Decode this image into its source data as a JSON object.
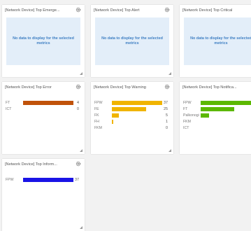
{
  "panels": [
    {
      "title": "[Network Device] Top Emerge...",
      "type": "empty",
      "message": "No data to display for the selected metrics"
    },
    {
      "title": "[Network Device] Top Alert",
      "type": "empty",
      "message": "No data to display for the selected metrics"
    },
    {
      "title": "[Network Device] Top Critical",
      "type": "empty",
      "message": "No data to display for the selected metrics"
    },
    {
      "title": "[Network Device] Top Error",
      "type": "bar",
      "color": "#c0520a",
      "max": 4,
      "rows": [
        {
          "label": "FT",
          "value": 4
        },
        {
          "label": "ICT",
          "value": 0
        }
      ]
    },
    {
      "title": "[Network Device] Top Warning",
      "type": "bar",
      "color": "#f0b400",
      "max": 37,
      "rows": [
        {
          "label": "FPW",
          "value": 37
        },
        {
          "label": "FE",
          "value": 25
        },
        {
          "label": "FK",
          "value": 5
        },
        {
          "label": "FH",
          "value": 1
        },
        {
          "label": "FKM",
          "value": 0
        }
      ]
    },
    {
      "title": "[Network Device] Top Notifica...",
      "type": "bar",
      "color": "#5cb800",
      "max": 6,
      "rows": [
        {
          "label": "FPW",
          "value": 6
        },
        {
          "label": "FT",
          "value": 4
        },
        {
          "label": "Palkonogi",
          "value": 1
        },
        {
          "label": "FKM",
          "value": 0
        },
        {
          "label": "ICT",
          "value": 0
        }
      ]
    },
    {
      "title": "[Network Device] Top Inform...",
      "type": "bar",
      "color": "#1a14e6",
      "max": 37,
      "rows": [
        {
          "label": "FPW",
          "value": 37
        }
      ]
    }
  ],
  "chart_data": [
    {
      "type": "bar",
      "title": "[Network Device] Top Error",
      "categories": [
        "FT",
        "ICT"
      ],
      "values": [
        4,
        0
      ]
    },
    {
      "type": "bar",
      "title": "[Network Device] Top Warning",
      "categories": [
        "FPW",
        "FE",
        "FK",
        "FH",
        "FKM"
      ],
      "values": [
        37,
        25,
        5,
        1,
        0
      ]
    },
    {
      "type": "bar",
      "title": "[Network Device] Top Notifica...",
      "categories": [
        "FPW",
        "FT",
        "Palkonogi",
        "FKM",
        "ICT"
      ],
      "values": [
        6,
        4,
        1,
        0,
        0
      ]
    },
    {
      "type": "bar",
      "title": "[Network Device] Top Inform...",
      "categories": [
        "FPW"
      ],
      "values": [
        37
      ]
    }
  ]
}
